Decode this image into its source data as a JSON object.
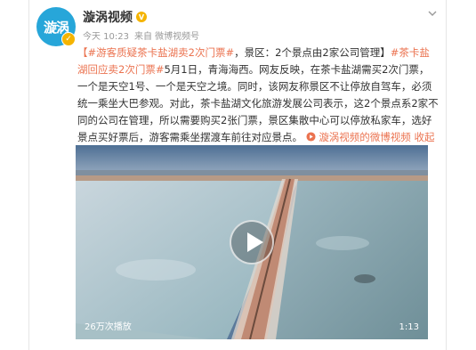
{
  "post": {
    "avatar_text": "漩涡",
    "author": "漩涡视频",
    "time": "今天 10:23",
    "source": "来自 微博视频号",
    "text_hl1": "【#游客质疑茶卡盐湖卖2次门票#",
    "text1": "，景区：2个景点由2家公司管理】",
    "text_hl2": "#茶卡盐湖回应卖2次门票#",
    "text2": "5月1日，青海海西。网友反映，在茶卡盐湖需买2次门票，一个是天空1号、一个是天空之境。同时，该网友称景区不让停放自驾车，必须统一乘坐大巴参观。对此，茶卡盐湖文化旅游发展公司表示，这2个景点系2家不同的公司在管理，所以需要购买2张门票，景区集散中心可以停放私家车，选好景点买好票后，游客需乘坐摆渡车前往对应景点。",
    "video_link": "漩涡视频的微博视频",
    "expand": "收起全文"
  },
  "video": {
    "views": "26万次播放",
    "duration": "1:13"
  },
  "colors": {
    "accent": "#eb7350",
    "brand": "#27a6d9"
  }
}
